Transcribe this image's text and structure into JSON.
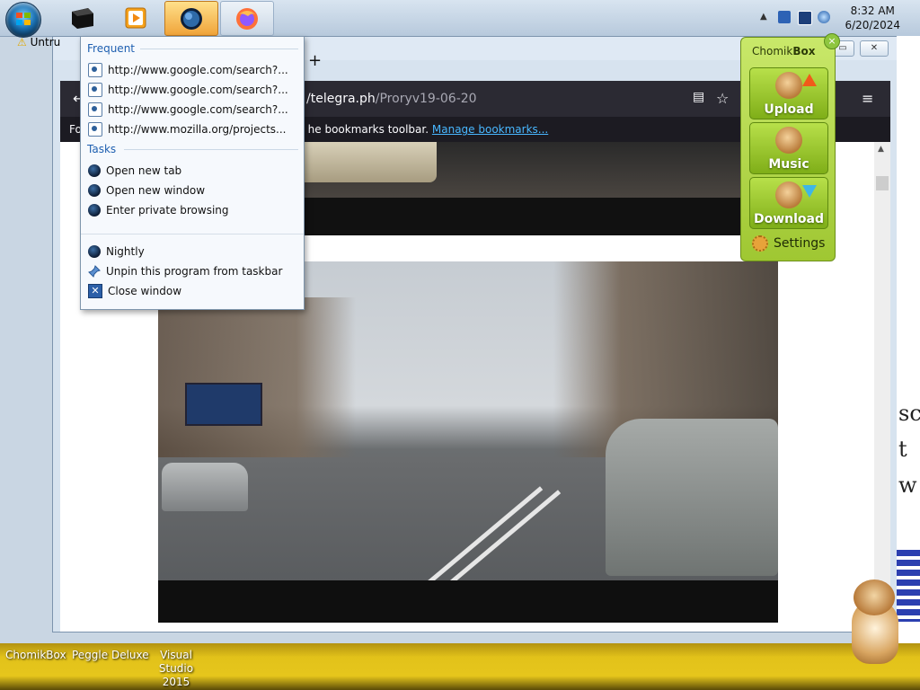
{
  "taskbar": {
    "clock_time": "8:32 AM",
    "clock_date": "6/20/2024",
    "apps": [
      {
        "name": "black-app-icon"
      },
      {
        "name": "media-player-icon"
      },
      {
        "name": "firefox-nightly-icon",
        "active": true
      },
      {
        "name": "firefox-icon"
      }
    ]
  },
  "firefox": {
    "title": "Untru",
    "url_host": "/telegra.ph",
    "url_path": "/Proryv19-06-20",
    "notice_prefix": "Fo",
    "notice_text": "he bookmarks toolbar.",
    "notice_link": "Manage bookmarks...",
    "new_tab": "+"
  },
  "jumplist": {
    "frequent_header": "Frequent",
    "frequent": [
      "http://www.google.com/search?...",
      "http://www.google.com/search?...",
      "http://www.google.com/search?...",
      "http://www.mozilla.org/projects..."
    ],
    "tasks_header": "Tasks",
    "tasks": [
      "Open new tab",
      "Open new window",
      "Enter private browsing"
    ],
    "footer": [
      "Nightly",
      "Unpin this program from taskbar",
      "Close window"
    ]
  },
  "chomikbox": {
    "title_light": "Chomik",
    "title_bold": "Box",
    "close": "×",
    "upload": "Upload",
    "music": "Music",
    "download": "Download",
    "settings": "Settings"
  },
  "desktop": {
    "labels": [
      "ChomikBox",
      "Peggle Deluxe",
      "Visual Studio 2015"
    ],
    "right_letters": [
      "scl",
      "t w"
    ]
  }
}
